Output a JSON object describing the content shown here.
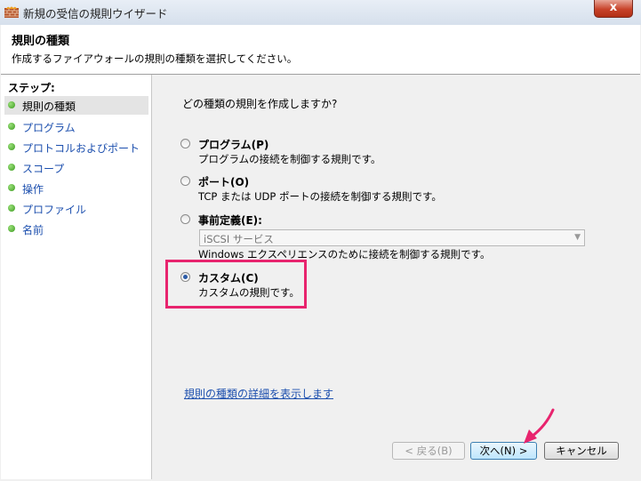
{
  "window": {
    "title": "新規の受信の規則ウイザード",
    "close_glyph": "x"
  },
  "header": {
    "title": "規則の種類",
    "subtitle": "作成するファイアウォールの規則の種類を選択してください。"
  },
  "steps": {
    "heading": "ステップ:",
    "items": [
      {
        "label": "規則の種類",
        "active": true
      },
      {
        "label": "プログラム",
        "active": false
      },
      {
        "label": "プロトコルおよびポート",
        "active": false
      },
      {
        "label": "スコープ",
        "active": false
      },
      {
        "label": "操作",
        "active": false
      },
      {
        "label": "プロファイル",
        "active": false
      },
      {
        "label": "名前",
        "active": false
      }
    ]
  },
  "main": {
    "question": "どの種類の規則を作成しますか?",
    "options": [
      {
        "title": "プログラム(P)",
        "desc": "プログラムの接続を制御する規則です。",
        "checked": false
      },
      {
        "title": "ポート(O)",
        "desc": "TCP または UDP ポートの接続を制御する規則です。",
        "checked": false
      },
      {
        "title": "事前定義(E):",
        "desc": "Windows エクスペリエンスのために接続を制御する規則です。",
        "checked": false
      },
      {
        "title": "カスタム(C)",
        "desc": "カスタムの規則です。",
        "checked": true
      }
    ],
    "predefined_combo": "iSCSI サービス",
    "help_link": "規則の種類の詳細を表示します"
  },
  "buttons": {
    "back": "< 戻る(B)",
    "next": "次へ(N) >",
    "cancel": "キャンセル"
  },
  "colors": {
    "highlight": "#e8246e",
    "link": "#1c4fae",
    "selection": "#2a5aa6"
  }
}
